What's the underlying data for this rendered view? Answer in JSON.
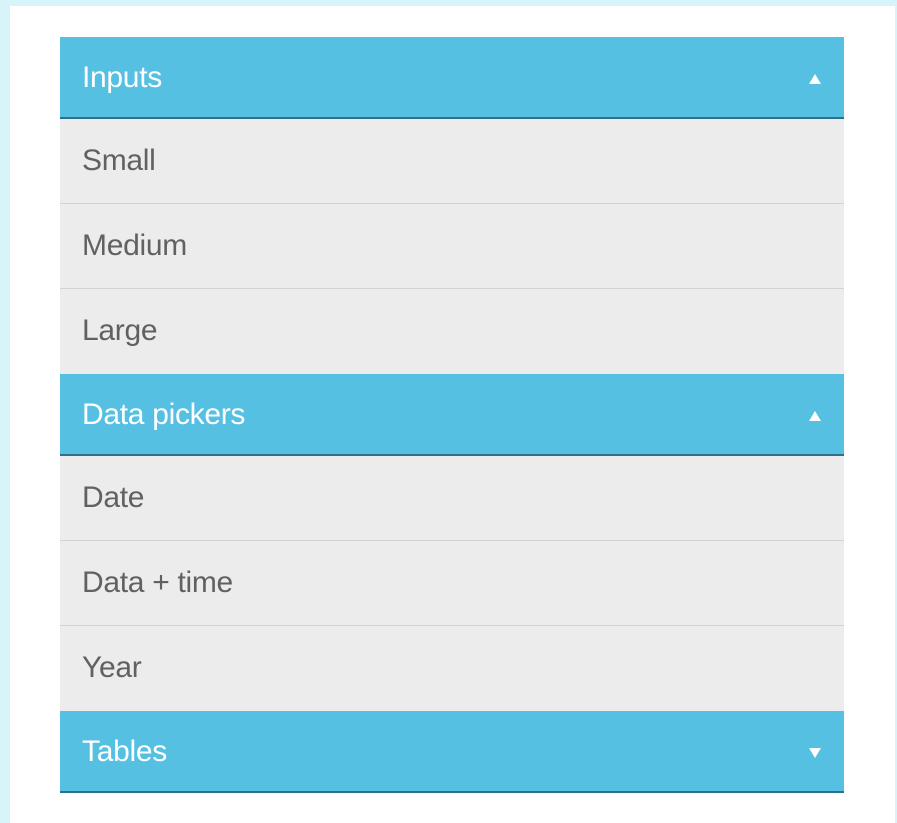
{
  "accordion": {
    "sections": [
      {
        "title": "Inputs",
        "state_icon": "caret-up-icon",
        "items": [
          "Small",
          "Medium",
          "Large"
        ]
      },
      {
        "title": "Data pickers",
        "state_icon": "caret-up-icon",
        "items": [
          "Date",
          "Data + time",
          "Year"
        ]
      },
      {
        "title": "Tables",
        "state_icon": "caret-down-icon",
        "items": []
      }
    ]
  },
  "colors": {
    "page_background": "#d8f4fb",
    "panel_background": "#ffffff",
    "header_background": "#55c0e2",
    "header_border": "#2f6f87",
    "header_text": "#ffffff",
    "item_background": "#ececec",
    "item_text": "#616161",
    "item_divider": "#d2d2d2"
  }
}
